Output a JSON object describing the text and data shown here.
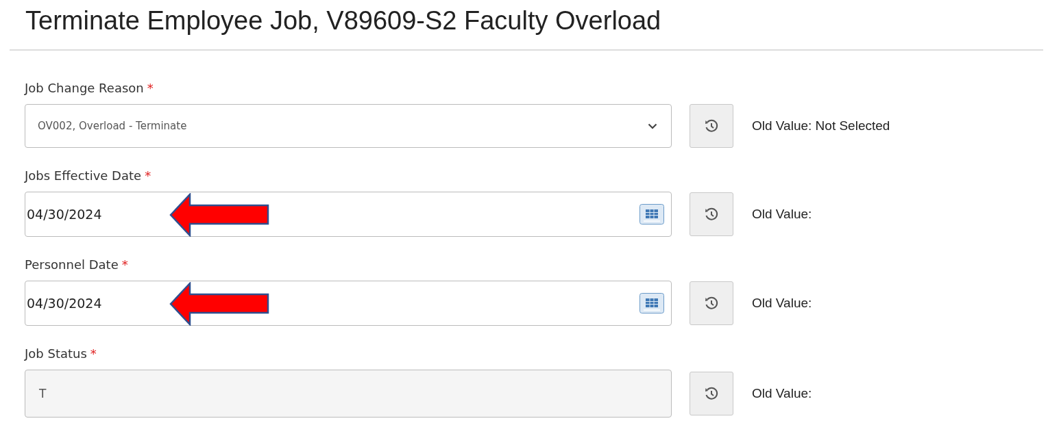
{
  "title": "Terminate Employee Job, V89609-S2 Faculty Overload",
  "fields": [
    {
      "kind": "select",
      "label": "Job Change Reason",
      "required_mark": "*",
      "value": "OV002, Overload - Terminate",
      "arrow": false,
      "old_value": "Old Value: Not Selected"
    },
    {
      "kind": "date",
      "label": "Jobs Effective Date",
      "required_mark": "*",
      "value": "04/30/2024",
      "arrow": true,
      "old_value": "Old Value:"
    },
    {
      "kind": "date",
      "label": "Personnel Date",
      "required_mark": "*",
      "value": "04/30/2024",
      "arrow": true,
      "old_value": "Old Value:"
    },
    {
      "kind": "readonly",
      "label": "Job Status",
      "required_mark": "*",
      "value": "T",
      "arrow": false,
      "old_value": "Old Value:"
    }
  ]
}
